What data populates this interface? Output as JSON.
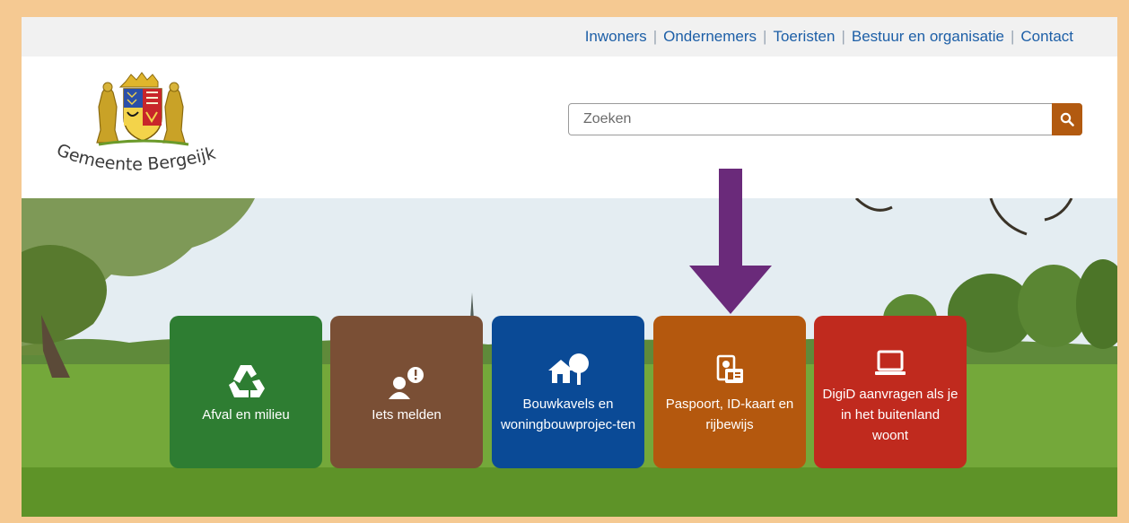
{
  "nav": {
    "links": [
      "Inwoners",
      "Ondernemers",
      "Toeristen",
      "Bestuur en organisatie",
      "Contact"
    ]
  },
  "logo": {
    "text": "Gemeente Bergeijk"
  },
  "search": {
    "placeholder": "Zoeken",
    "icon": "search-icon"
  },
  "tiles": [
    {
      "label": "Afval en milieu",
      "color": "#2e7d32",
      "icon": "recycle-icon"
    },
    {
      "label": "Iets melden",
      "color": "#7a4f35",
      "icon": "person-alert-icon"
    },
    {
      "label": "Bouwkavels en woningbouwprojec-ten",
      "color": "#0a4a96",
      "icon": "house-tree-icon"
    },
    {
      "label": "Paspoort, ID-kaart en rijbewijs",
      "color": "#b4580e",
      "icon": "id-card-icon"
    },
    {
      "label": "DigiD aanvragen als je in het buitenland woont",
      "color": "#c02a1e",
      "icon": "laptop-icon"
    }
  ],
  "colors": {
    "accent": "#b25a10",
    "nav_link": "#1d5fa7",
    "arrow": "#6a2a7a",
    "frame": "#f5c992"
  }
}
